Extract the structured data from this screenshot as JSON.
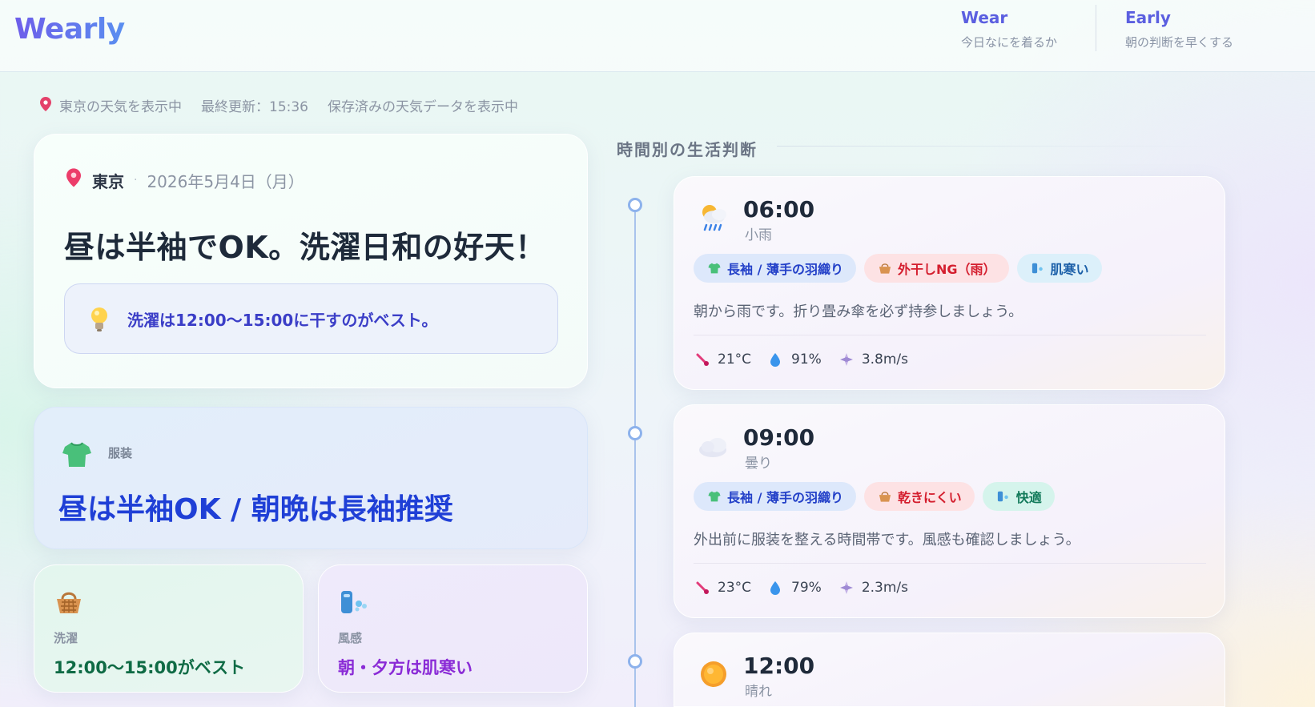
{
  "header": {
    "logo": "Wearly",
    "nav": [
      {
        "title": "Wear",
        "subtitle": "今日なにを着るか"
      },
      {
        "title": "Early",
        "subtitle": "朝の判断を早くする"
      }
    ]
  },
  "status": {
    "location_text": "東京の天気を表示中",
    "last_updated": "最終更新：15:36",
    "cache_note": "保存済みの天気データを表示中"
  },
  "summary": {
    "city": "東京",
    "date": "2026年5月4日（月）",
    "headline": "昼は半袖でOK。洗濯日和の好天！",
    "tip": "洗濯は12:00〜15:00に干すのがベスト。"
  },
  "outfit": {
    "label": "服装",
    "text": "昼は半袖OK / 朝晩は長袖推奨"
  },
  "laundry": {
    "label": "洗濯",
    "value": "12:00〜15:00がベスト"
  },
  "wind": {
    "label": "風感",
    "value": "朝・夕方は肌寒い"
  },
  "timeline": {
    "title": "時間別の生活判断",
    "hours": [
      {
        "time": "06:00",
        "condition": "小雨",
        "icon": "rain-icon",
        "tags": [
          {
            "label": "長袖 / 薄手の羽織り",
            "style": "blue",
            "icon": "shirt-icon"
          },
          {
            "label": "外干しNG（雨）",
            "style": "red",
            "icon": "basket-icon"
          },
          {
            "label": "肌寒い",
            "style": "cyan",
            "icon": "wind-icon"
          }
        ],
        "description": "朝から雨です。折り畳み傘を必ず持参しましょう。",
        "temperature": "21°C",
        "humidity": "91%",
        "wind_speed": "3.8m/s"
      },
      {
        "time": "09:00",
        "condition": "曇り",
        "icon": "cloud-icon",
        "tags": [
          {
            "label": "長袖 / 薄手の羽織り",
            "style": "blue",
            "icon": "shirt-icon"
          },
          {
            "label": "乾きにくい",
            "style": "red",
            "icon": "basket-icon"
          },
          {
            "label": "快適",
            "style": "mint",
            "icon": "wind-icon"
          }
        ],
        "description": "外出前に服装を整える時間帯です。風感も確認しましょう。",
        "temperature": "23°C",
        "humidity": "79%",
        "wind_speed": "2.3m/s"
      },
      {
        "time": "12:00",
        "condition": "晴れ",
        "icon": "sun-icon"
      }
    ]
  },
  "colors": {
    "brand": "#5b5fe0",
    "outfit_text": "#1f3fd6",
    "laundry_text": "#0f6b45",
    "wind_text": "#8a2bd6",
    "tag_red": "#d41e2e",
    "tag_blue": "#2340c8"
  }
}
